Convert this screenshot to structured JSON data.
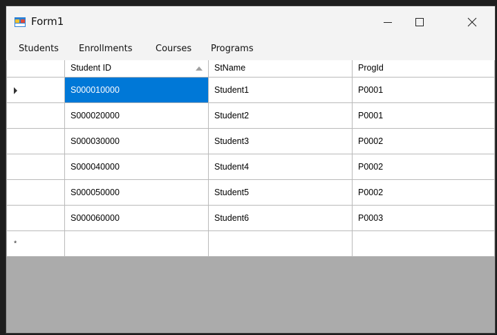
{
  "window": {
    "title": "Form1"
  },
  "menu": {
    "items": [
      "Students",
      "Enrollments",
      "Courses",
      "Programs"
    ]
  },
  "grid": {
    "columns": [
      "Student ID",
      "StName",
      "ProgId"
    ],
    "sorted_column": "Student ID",
    "sort_direction": "ascending",
    "rows": [
      [
        "S000010000",
        "Student1",
        "P0001"
      ],
      [
        "S000020000",
        "Student2",
        "P0001"
      ],
      [
        "S000030000",
        "Student3",
        "P0002"
      ],
      [
        "S000040000",
        "Student4",
        "P0002"
      ],
      [
        "S000050000",
        "Student5",
        "P0002"
      ],
      [
        "S000060000",
        "Student6",
        "P0003"
      ]
    ],
    "new_row_marker": "*"
  },
  "colors": {
    "selection": "#0078d7",
    "grid_background": "#ababab"
  }
}
